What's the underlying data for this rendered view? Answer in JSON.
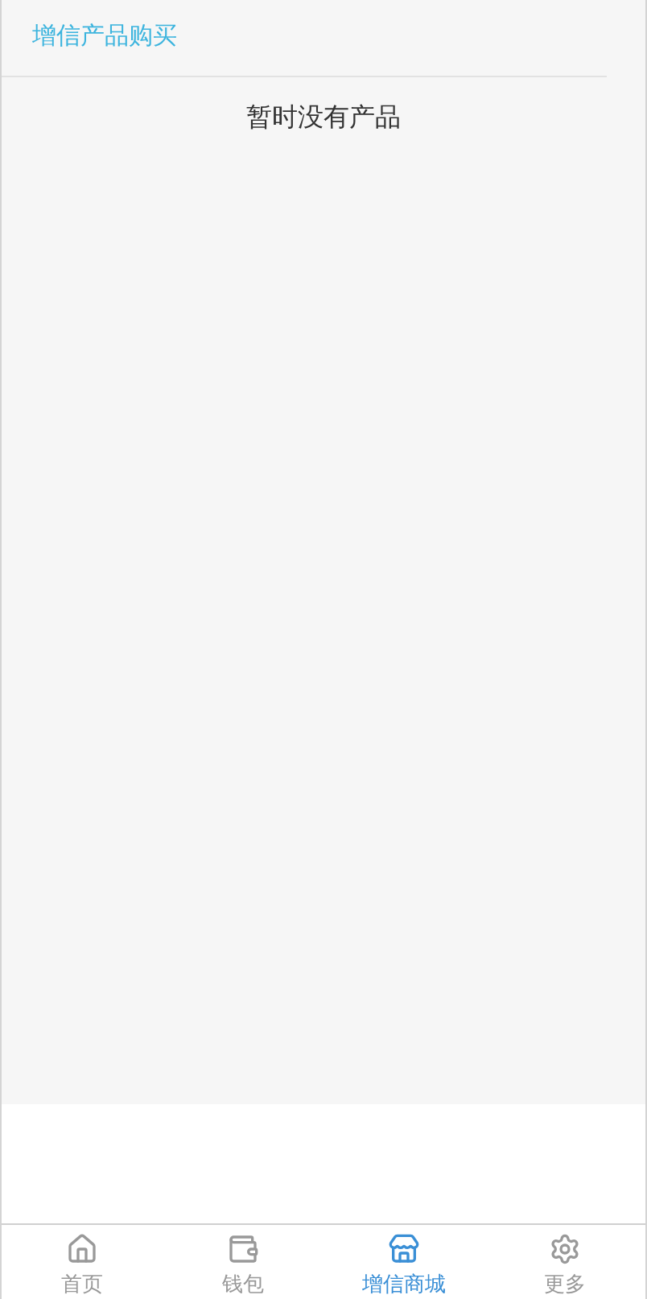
{
  "header": {
    "title": "增信产品购买"
  },
  "empty_message": "暂时没有产品",
  "tabs": [
    {
      "label": "首页",
      "kind": "home",
      "selected": false
    },
    {
      "label": "钱包",
      "kind": "wallet",
      "selected": false
    },
    {
      "label": "增信商城",
      "kind": "store",
      "selected": true
    },
    {
      "label": "更多",
      "kind": "more",
      "selected": false
    }
  ]
}
